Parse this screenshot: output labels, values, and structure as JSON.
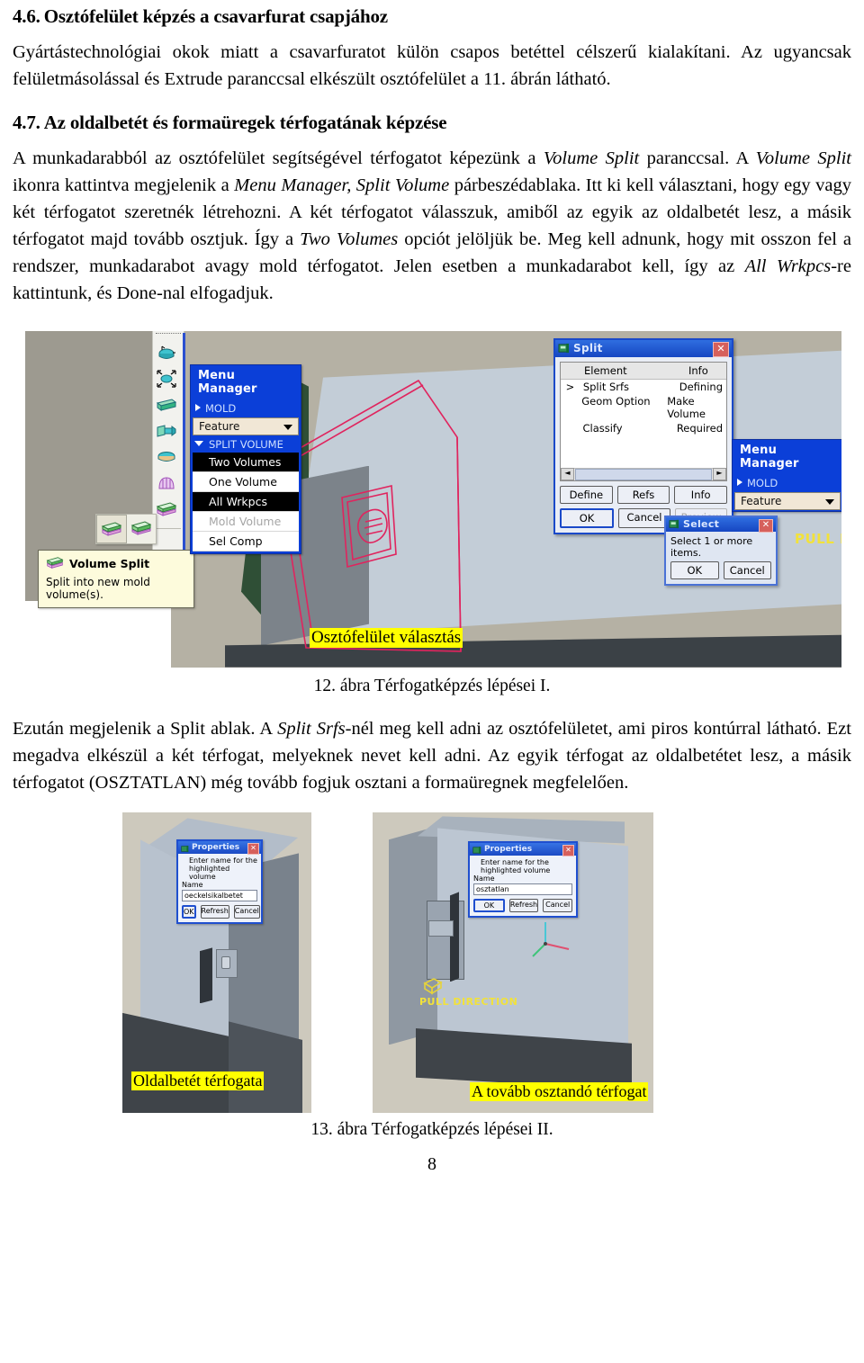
{
  "document": {
    "page_number": "8"
  },
  "sections": [
    {
      "number": "4.6.",
      "title": "Osztófelület képzés a csavarfurat csapjához",
      "paragraph_parts": [
        {
          "t": "Gyártástechnológiai okok miatt a csavarfuratot külön csapos betéttel célszerű kialakítani. Az ugyancsak felületmásolással és Extrude paranccsal elkészült osztófelület a 11. ábrán látható.",
          "i": false
        }
      ]
    },
    {
      "number": "4.7.",
      "title": "Az oldalbetét és formaüregek térfogatának képzése",
      "paragraph_parts": [
        {
          "t": "A munkadarabból az osztófelület segítségével térfogatot képezünk a ",
          "i": false
        },
        {
          "t": "Volume Split",
          "i": true
        },
        {
          "t": " paranccsal. A ",
          "i": false
        },
        {
          "t": "Volume Split",
          "i": true
        },
        {
          "t": " ikonra kattintva megjelenik a ",
          "i": false
        },
        {
          "t": "Menu Manager, Split Volume",
          "i": true
        },
        {
          "t": " párbeszédablaka. Itt ki kell választani, hogy egy vagy két térfogatot szeretnék létrehozni. A két térfogatot válasszuk, amiből az egyik az oldalbetét lesz, a másik térfogatot majd tovább osztjuk. Így a ",
          "i": false
        },
        {
          "t": "Two Volumes",
          "i": true
        },
        {
          "t": " opciót jelöljük be. Meg kell adnunk, hogy mit osszon fel a rendszer, munkadarabot avagy mold térfogatot. Jelen esetben a munkadarabot kell, így az ",
          "i": false
        },
        {
          "t": "All Wrkpcs",
          "i": true
        },
        {
          "t": "-re kattintunk, és Done-nal elfogadjuk.",
          "i": false
        }
      ]
    }
  ],
  "figure12": {
    "caption": "12. ábra Térfogatképzés lépései I.",
    "menu_manager": {
      "title": "Menu Manager",
      "mold_label": "MOLD",
      "feature_label": "Feature",
      "split_volume_label": "SPLIT VOLUME",
      "items": [
        {
          "label": "Two Volumes",
          "state": "selected"
        },
        {
          "label": "One Volume",
          "state": "normal"
        },
        {
          "label": "All Wrkpcs",
          "state": "selected"
        },
        {
          "label": "Mold Volume",
          "state": "disabled"
        },
        {
          "label": "Sel Comp",
          "state": "normal"
        }
      ]
    },
    "tooltip": {
      "title": "Volume Split",
      "body": "Split into new mold volume(s)."
    },
    "split_dialog": {
      "title": "Split",
      "col_element": "Element",
      "col_info": "Info",
      "rows": [
        {
          "marker": ">",
          "element": "Split Srfs",
          "info": "Defining"
        },
        {
          "marker": "",
          "element": "Geom Option",
          "info": "Make Volume"
        },
        {
          "marker": "",
          "element": "Classify",
          "info": "Required"
        }
      ],
      "buttons": [
        "Define",
        "Refs",
        "Info",
        "OK",
        "Cancel",
        "Preview"
      ]
    },
    "menu_manager2": {
      "title": "Menu Manager",
      "mold_label": "MOLD",
      "feature_label": "Feature"
    },
    "select_dialog": {
      "title": "Select",
      "message": "Select 1 or more items.",
      "ok": "OK",
      "cancel": "Cancel"
    },
    "pull_direction_label": "PULL DIR",
    "highlight_label": "Osztófelület választás"
  },
  "paragraph_after_fig12": [
    {
      "t": "Ezután megjelenik a Split ablak. A ",
      "i": false
    },
    {
      "t": "Split Srfs",
      "i": true
    },
    {
      "t": "-nél meg kell adni az osztófelületet, ami piros kontúrral látható. Ezt megadva elkészül a két térfogat, melyeknek nevet kell adni. Az egyik térfogat az oldalbetétet lesz, a másik térfogatot (OSZTATLAN) még tovább fogjuk osztani a formaüregnek megfelelően.",
      "i": false
    }
  ],
  "figure13": {
    "caption": "13. ábra Térfogatképzés lépései II.",
    "left": {
      "dialog": {
        "title": "Properties",
        "prompt": "Enter name for the highlighted volume",
        "name_label": "Name",
        "value": "oeckelsikalbetet",
        "buttons": [
          "OK",
          "Refresh",
          "Cancel"
        ]
      },
      "label": "Oldalbetét térfogata"
    },
    "right": {
      "dialog": {
        "title": "Properties",
        "prompt": "Enter name for the highlighted volume",
        "name_label": "Name",
        "value": "osztatlan",
        "buttons": [
          "OK",
          "Refresh",
          "Cancel"
        ]
      },
      "pull_direction": "PULL DIRECTION",
      "label": "A tovább osztandó térfogat"
    }
  },
  "colors": {
    "highlight_yellow": "#ffff00",
    "menu_blue": "#0b3fd8",
    "dialog_blue": "#1a49c9",
    "red_contour": "#e0245e",
    "green_face": "#2f4f36"
  }
}
